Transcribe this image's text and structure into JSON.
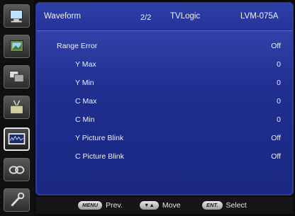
{
  "sidebar": {
    "items": [
      {
        "icon": "monitor-icon"
      },
      {
        "icon": "picture-icon"
      },
      {
        "icon": "multi-window-icon"
      },
      {
        "icon": "antenna-tv-icon"
      },
      {
        "icon": "waveform-scope-icon",
        "active": true
      },
      {
        "icon": "loop-icon"
      },
      {
        "icon": "wrench-icon"
      }
    ]
  },
  "header": {
    "title": "Waveform",
    "page": "2/2",
    "brand": "TVLogic",
    "model": "LVM-075A"
  },
  "menu": {
    "rows": [
      {
        "label": "Range Error",
        "value": "Off"
      },
      {
        "label": "Y Max",
        "value": "0"
      },
      {
        "label": "Y Min",
        "value": "0"
      },
      {
        "label": "C Max",
        "value": "0"
      },
      {
        "label": "C Min",
        "value": "0"
      },
      {
        "label": "Y Picture Blink",
        "value": "Off"
      },
      {
        "label": "C Picture Blink",
        "value": "Off"
      }
    ]
  },
  "footer": {
    "prev_key": "MENU",
    "prev_label": "Prev.",
    "move_key": "▼▲",
    "move_label": "Move",
    "select_key": "ENT.",
    "select_label": "Select"
  }
}
